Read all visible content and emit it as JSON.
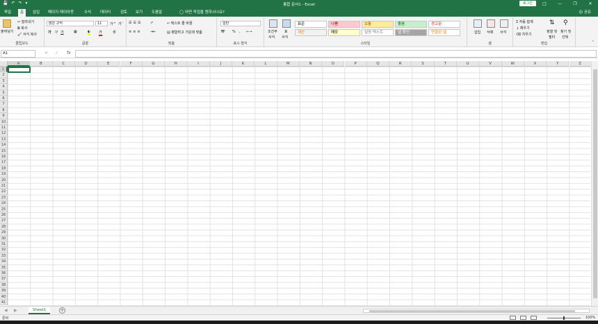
{
  "titlebar": {
    "title": "통합 문서1  -  Excel",
    "login": "로그인",
    "qat": [
      "save-icon",
      "undo-icon",
      "redo-icon",
      "customize-icon"
    ]
  },
  "tabs": {
    "items": [
      "파일",
      "홈",
      "삽입",
      "페이지 레이아웃",
      "수식",
      "데이터",
      "검토",
      "보기",
      "도움말"
    ],
    "active": "홈",
    "tellme": "어떤 작업을 원하시나요?",
    "share": "공유"
  },
  "ribbon": {
    "clipboard": {
      "label": "클립보드",
      "paste": "붙여넣기",
      "cut": "잘라내기",
      "copy": "복사",
      "format_painter": "서식 복사"
    },
    "font": {
      "label": "글꼴",
      "font_name": "맑은 고딕",
      "font_size": "11",
      "grow": "가",
      "shrink": "가",
      "bold": "가",
      "italic": "가",
      "underline": "가"
    },
    "alignment": {
      "label": "맞춤",
      "wrap": "텍스트 줄 바꿈",
      "merge": "병합하고 가운데 맞춤"
    },
    "number": {
      "label": "표시 형식",
      "format": "일반",
      "percent": "%",
      "comma": ","
    },
    "styles": {
      "label": "스타일",
      "conditional": [
        "조건부",
        "서식"
      ],
      "table": [
        "표",
        "서식"
      ],
      "cells": [
        {
          "name": "표준",
          "bg": "#ffffff",
          "fg": "#000000"
        },
        {
          "name": "나쁨",
          "bg": "#ffc7ce",
          "fg": "#9c0006"
        },
        {
          "name": "보통",
          "bg": "#ffeb9c",
          "fg": "#9c5700"
        },
        {
          "name": "좋음",
          "bg": "#c6efce",
          "fg": "#006100"
        },
        {
          "name": "경고문",
          "bg": "#ffffff",
          "fg": "#ff0000"
        },
        {
          "name": "계산",
          "bg": "#f2f2f2",
          "fg": "#fa7d00"
        },
        {
          "name": "메모",
          "bg": "#ffffcc",
          "fg": "#000000"
        },
        {
          "name": "설명 텍스트",
          "bg": "#ffffff",
          "fg": "#7f7f7f"
        },
        {
          "name": "셀 확인",
          "bg": "#a5a5a5",
          "fg": "#ffffff"
        },
        {
          "name": "연결된 셀",
          "bg": "#ffffff",
          "fg": "#fa7d00"
        }
      ]
    },
    "cells": {
      "label": "셀",
      "insert": "삽입",
      "delete": "삭제",
      "format": "서식"
    },
    "editing": {
      "label": "편집",
      "autosum": "자동 합계",
      "fill": "채우기",
      "clear": "지우기",
      "sort": [
        "정렬 및",
        "필터"
      ],
      "find": [
        "찾기 및",
        "선택"
      ]
    }
  },
  "formula_bar": {
    "name_box": "A1",
    "fx": "fx",
    "value": ""
  },
  "grid": {
    "columns": [
      "A",
      "B",
      "C",
      "D",
      "E",
      "F",
      "G",
      "H",
      "I",
      "J",
      "K",
      "L",
      "M",
      "N",
      "O",
      "P",
      "Q",
      "R",
      "S",
      "T",
      "U",
      "V",
      "W",
      "X",
      "Y",
      "Z"
    ],
    "rows": [
      "1",
      "2",
      "3",
      "4",
      "5",
      "6",
      "7",
      "8",
      "9",
      "10",
      "11",
      "12",
      "13",
      "14",
      "15",
      "16",
      "17",
      "18",
      "19",
      "20",
      "21",
      "22",
      "23",
      "24",
      "25",
      "26",
      "27",
      "28",
      "29",
      "30",
      "31",
      "32",
      "33",
      "34",
      "35",
      "36",
      "37",
      "38",
      "39",
      "40",
      "41"
    ],
    "selected_cell": "A1"
  },
  "sheets": {
    "tabs": [
      "Sheet1"
    ],
    "active": "Sheet1",
    "add": "+"
  },
  "status": {
    "ready": "준비",
    "zoom": "100%"
  },
  "colors": {
    "accent": "#217346"
  }
}
